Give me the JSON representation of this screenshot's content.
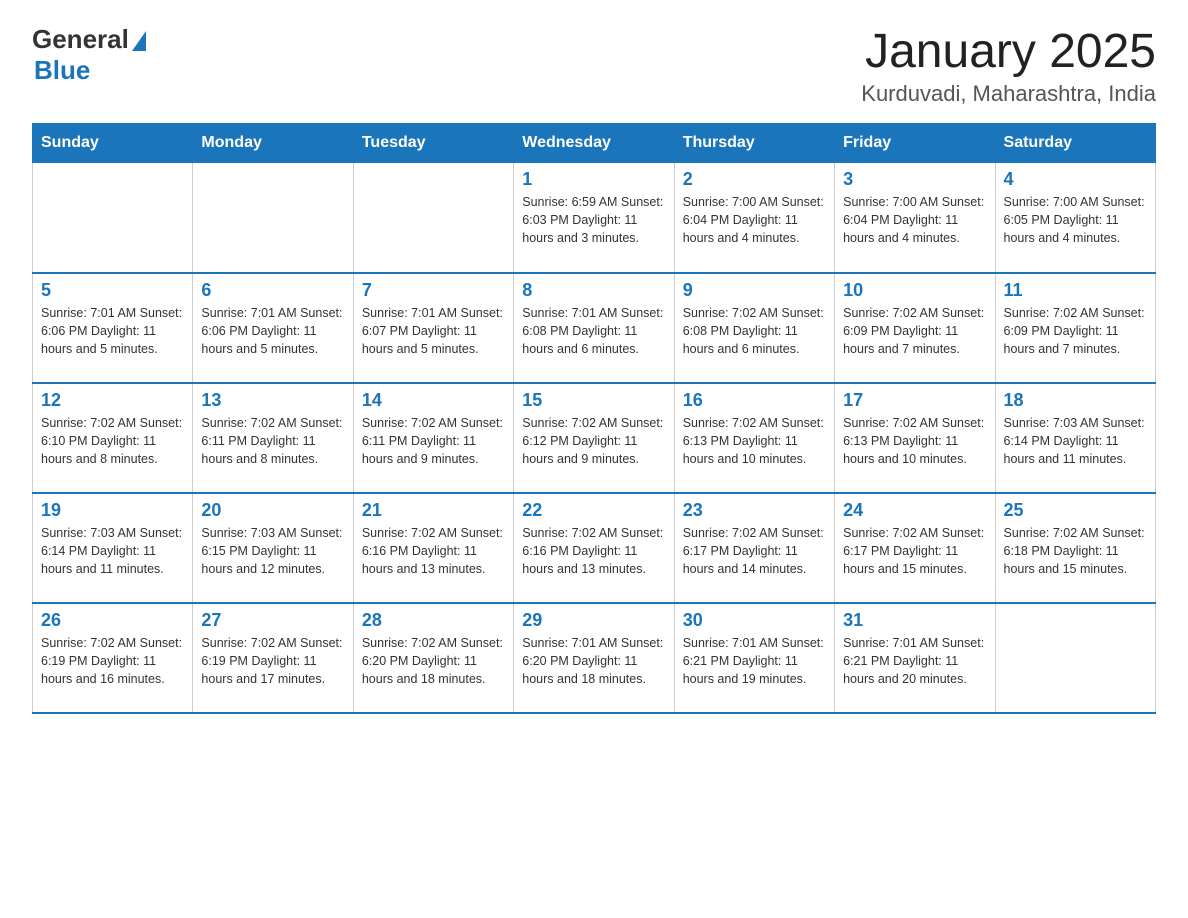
{
  "header": {
    "logo_general": "General",
    "logo_blue": "Blue",
    "month_title": "January 2025",
    "location": "Kurduvadi, Maharashtra, India"
  },
  "calendar": {
    "days_of_week": [
      "Sunday",
      "Monday",
      "Tuesday",
      "Wednesday",
      "Thursday",
      "Friday",
      "Saturday"
    ],
    "weeks": [
      [
        {
          "day": "",
          "info": ""
        },
        {
          "day": "",
          "info": ""
        },
        {
          "day": "",
          "info": ""
        },
        {
          "day": "1",
          "info": "Sunrise: 6:59 AM\nSunset: 6:03 PM\nDaylight: 11 hours and 3 minutes."
        },
        {
          "day": "2",
          "info": "Sunrise: 7:00 AM\nSunset: 6:04 PM\nDaylight: 11 hours and 4 minutes."
        },
        {
          "day": "3",
          "info": "Sunrise: 7:00 AM\nSunset: 6:04 PM\nDaylight: 11 hours and 4 minutes."
        },
        {
          "day": "4",
          "info": "Sunrise: 7:00 AM\nSunset: 6:05 PM\nDaylight: 11 hours and 4 minutes."
        }
      ],
      [
        {
          "day": "5",
          "info": "Sunrise: 7:01 AM\nSunset: 6:06 PM\nDaylight: 11 hours and 5 minutes."
        },
        {
          "day": "6",
          "info": "Sunrise: 7:01 AM\nSunset: 6:06 PM\nDaylight: 11 hours and 5 minutes."
        },
        {
          "day": "7",
          "info": "Sunrise: 7:01 AM\nSunset: 6:07 PM\nDaylight: 11 hours and 5 minutes."
        },
        {
          "day": "8",
          "info": "Sunrise: 7:01 AM\nSunset: 6:08 PM\nDaylight: 11 hours and 6 minutes."
        },
        {
          "day": "9",
          "info": "Sunrise: 7:02 AM\nSunset: 6:08 PM\nDaylight: 11 hours and 6 minutes."
        },
        {
          "day": "10",
          "info": "Sunrise: 7:02 AM\nSunset: 6:09 PM\nDaylight: 11 hours and 7 minutes."
        },
        {
          "day": "11",
          "info": "Sunrise: 7:02 AM\nSunset: 6:09 PM\nDaylight: 11 hours and 7 minutes."
        }
      ],
      [
        {
          "day": "12",
          "info": "Sunrise: 7:02 AM\nSunset: 6:10 PM\nDaylight: 11 hours and 8 minutes."
        },
        {
          "day": "13",
          "info": "Sunrise: 7:02 AM\nSunset: 6:11 PM\nDaylight: 11 hours and 8 minutes."
        },
        {
          "day": "14",
          "info": "Sunrise: 7:02 AM\nSunset: 6:11 PM\nDaylight: 11 hours and 9 minutes."
        },
        {
          "day": "15",
          "info": "Sunrise: 7:02 AM\nSunset: 6:12 PM\nDaylight: 11 hours and 9 minutes."
        },
        {
          "day": "16",
          "info": "Sunrise: 7:02 AM\nSunset: 6:13 PM\nDaylight: 11 hours and 10 minutes."
        },
        {
          "day": "17",
          "info": "Sunrise: 7:02 AM\nSunset: 6:13 PM\nDaylight: 11 hours and 10 minutes."
        },
        {
          "day": "18",
          "info": "Sunrise: 7:03 AM\nSunset: 6:14 PM\nDaylight: 11 hours and 11 minutes."
        }
      ],
      [
        {
          "day": "19",
          "info": "Sunrise: 7:03 AM\nSunset: 6:14 PM\nDaylight: 11 hours and 11 minutes."
        },
        {
          "day": "20",
          "info": "Sunrise: 7:03 AM\nSunset: 6:15 PM\nDaylight: 11 hours and 12 minutes."
        },
        {
          "day": "21",
          "info": "Sunrise: 7:02 AM\nSunset: 6:16 PM\nDaylight: 11 hours and 13 minutes."
        },
        {
          "day": "22",
          "info": "Sunrise: 7:02 AM\nSunset: 6:16 PM\nDaylight: 11 hours and 13 minutes."
        },
        {
          "day": "23",
          "info": "Sunrise: 7:02 AM\nSunset: 6:17 PM\nDaylight: 11 hours and 14 minutes."
        },
        {
          "day": "24",
          "info": "Sunrise: 7:02 AM\nSunset: 6:17 PM\nDaylight: 11 hours and 15 minutes."
        },
        {
          "day": "25",
          "info": "Sunrise: 7:02 AM\nSunset: 6:18 PM\nDaylight: 11 hours and 15 minutes."
        }
      ],
      [
        {
          "day": "26",
          "info": "Sunrise: 7:02 AM\nSunset: 6:19 PM\nDaylight: 11 hours and 16 minutes."
        },
        {
          "day": "27",
          "info": "Sunrise: 7:02 AM\nSunset: 6:19 PM\nDaylight: 11 hours and 17 minutes."
        },
        {
          "day": "28",
          "info": "Sunrise: 7:02 AM\nSunset: 6:20 PM\nDaylight: 11 hours and 18 minutes."
        },
        {
          "day": "29",
          "info": "Sunrise: 7:01 AM\nSunset: 6:20 PM\nDaylight: 11 hours and 18 minutes."
        },
        {
          "day": "30",
          "info": "Sunrise: 7:01 AM\nSunset: 6:21 PM\nDaylight: 11 hours and 19 minutes."
        },
        {
          "day": "31",
          "info": "Sunrise: 7:01 AM\nSunset: 6:21 PM\nDaylight: 11 hours and 20 minutes."
        },
        {
          "day": "",
          "info": ""
        }
      ]
    ]
  }
}
